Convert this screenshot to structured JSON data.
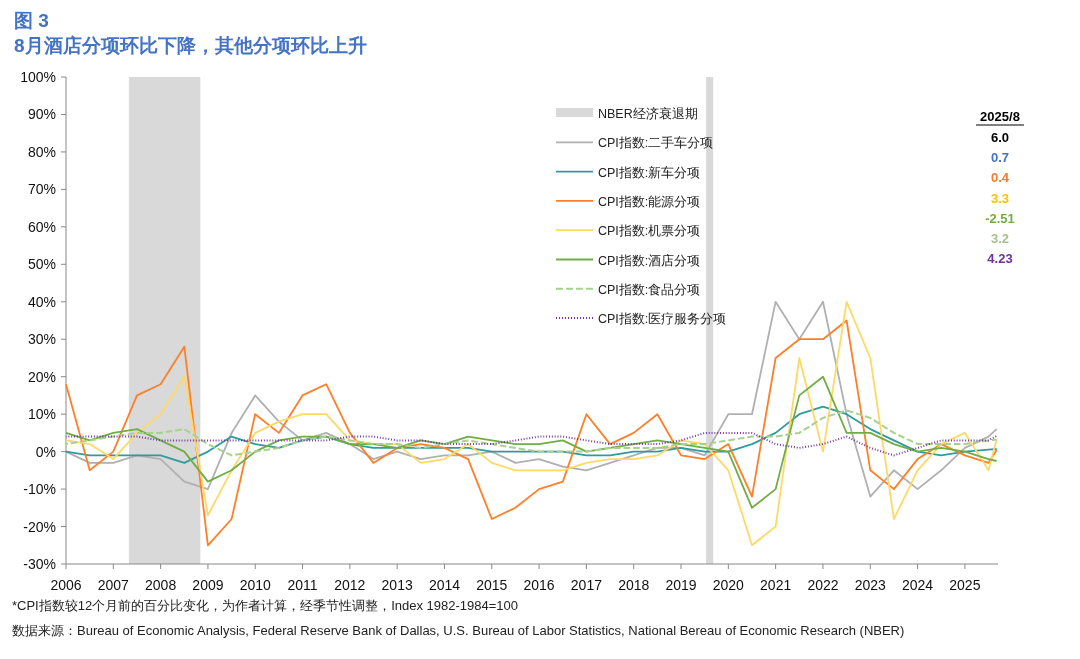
{
  "figure": {
    "label": "图 3",
    "title": "8月酒店分项环比下降，其他分项环比上升"
  },
  "chart": {
    "chart_data": {
      "type": "line",
      "x": [
        2006,
        2006.5,
        2007,
        2007.5,
        2008,
        2008.5,
        2009,
        2009.5,
        2010,
        2010.5,
        2011,
        2011.5,
        2012,
        2012.5,
        2013,
        2013.5,
        2014,
        2014.5,
        2015,
        2015.5,
        2016,
        2016.5,
        2017,
        2017.5,
        2018,
        2018.5,
        2019,
        2019.5,
        2020,
        2020.5,
        2021,
        2021.5,
        2022,
        2022.5,
        2023,
        2023.5,
        2024,
        2024.5,
        2025,
        2025.5,
        2025.67
      ],
      "series": [
        {
          "name": "CPI指数:二手车分项",
          "color": "#b0b0b0",
          "line_style": "solid",
          "values": [
            0,
            -3,
            -3,
            -1,
            -2,
            -8,
            -10,
            5,
            15,
            8,
            3,
            5,
            2,
            -2,
            0,
            -2,
            -1,
            -1,
            0,
            -3,
            -2,
            -4,
            -5,
            -3,
            -1,
            1,
            1,
            -1,
            10,
            10,
            40,
            30,
            40,
            10,
            -12,
            -5,
            -10,
            -5,
            1,
            4,
            6
          ]
        },
        {
          "name": "CPI指数:新车分项",
          "color": "#2e9c9c",
          "line_style": "solid",
          "values": [
            0,
            -1,
            -1,
            -1,
            -1,
            -3,
            0,
            4,
            2,
            1,
            3,
            4,
            2,
            1,
            1,
            1,
            1,
            1,
            0,
            0,
            0,
            0,
            -1,
            -1,
            0,
            0,
            1,
            0,
            0,
            2,
            5,
            10,
            12,
            10,
            6,
            3,
            0,
            -1,
            0,
            0.5,
            0.7
          ]
        },
        {
          "name": "CPI指数:能源分项",
          "color": "#ff7f27",
          "line_style": "solid",
          "values": [
            18,
            -5,
            0,
            15,
            18,
            28,
            -25,
            -18,
            10,
            5,
            15,
            18,
            5,
            -3,
            1,
            2,
            1,
            -2,
            -18,
            -15,
            -10,
            -8,
            10,
            2,
            5,
            10,
            -1,
            -2,
            2,
            -12,
            25,
            30,
            30,
            35,
            -5,
            -10,
            -2,
            2,
            -1,
            -3,
            0.4
          ]
        },
        {
          "name": "CPI指数:机票分项",
          "color": "#ffd966",
          "line_style": "solid",
          "values": [
            3,
            2,
            -2,
            5,
            10,
            20,
            -17,
            -5,
            5,
            8,
            10,
            10,
            3,
            2,
            2,
            -3,
            -2,
            2,
            -3,
            -5,
            -5,
            -5,
            -3,
            -2,
            -2,
            -1,
            3,
            2,
            -5,
            -25,
            -20,
            25,
            0,
            40,
            25,
            -18,
            -5,
            2,
            5,
            -5,
            3.3
          ]
        },
        {
          "name": "CPI指数:酒店分项",
          "color": "#70ad47",
          "line_style": "solid",
          "values": [
            5,
            3,
            5,
            6,
            3,
            0,
            -8,
            -5,
            0,
            3,
            4,
            4,
            2,
            2,
            1,
            3,
            2,
            4,
            3,
            2,
            2,
            3,
            0,
            1,
            2,
            3,
            2,
            1,
            0,
            -15,
            -10,
            15,
            20,
            5,
            5,
            2,
            0,
            1,
            0,
            -2,
            -2.5
          ]
        },
        {
          "name": "CPI指数:食品分项",
          "color": "#a9d18e",
          "line_style": "dashed",
          "values": [
            2,
            3,
            4,
            5,
            5,
            6,
            2,
            -1,
            0,
            1,
            3,
            4,
            3,
            2,
            2,
            1,
            2,
            3,
            2,
            1,
            0,
            0,
            0,
            1,
            1,
            1,
            2,
            2,
            3,
            4,
            4,
            5,
            9,
            11,
            9,
            5,
            2,
            2,
            2,
            3,
            3.2
          ]
        },
        {
          "name": "CPI指数:医疗服务分项",
          "color": "#7030a0",
          "line_style": "dotted",
          "values": [
            4,
            4,
            4,
            4,
            3,
            3,
            3,
            3,
            3,
            3,
            3,
            3,
            4,
            4,
            3,
            3,
            2,
            2,
            2,
            3,
            4,
            4,
            3,
            2,
            2,
            2,
            3,
            5,
            5,
            5,
            2,
            1,
            2,
            4,
            1,
            -1,
            1,
            3,
            3,
            3,
            4.2
          ]
        }
      ],
      "xlim": [
        2006,
        2025.7
      ],
      "ylim": [
        -30,
        100
      ],
      "xticks": [
        2006,
        2007,
        2008,
        2009,
        2010,
        2011,
        2012,
        2013,
        2014,
        2015,
        2016,
        2017,
        2018,
        2019,
        2020,
        2021,
        2022,
        2023,
        2024,
        2025
      ],
      "yticks": [
        {
          "value": -30,
          "label": "-30%"
        },
        {
          "value": -20,
          "label": "-20%"
        },
        {
          "value": -10,
          "label": "-10%"
        },
        {
          "value": 0,
          "label": "0%"
        },
        {
          "value": 10,
          "label": "10%"
        },
        {
          "value": 20,
          "label": "20%"
        },
        {
          "value": 30,
          "label": "30%"
        },
        {
          "value": 40,
          "label": "40%"
        },
        {
          "value": 50,
          "label": "50%"
        },
        {
          "value": 60,
          "label": "60%"
        },
        {
          "value": 70,
          "label": "70%"
        },
        {
          "value": 80,
          "label": "80%"
        },
        {
          "value": 90,
          "label": "90%"
        },
        {
          "value": 100,
          "label": "100%"
        }
      ],
      "bands": [
        {
          "axis": "x",
          "color": "#d9d9d9",
          "from": 2007.33,
          "to": 2008.84
        },
        {
          "axis": "x",
          "color": "#d9d9d9",
          "from": 2019.53,
          "to": 2019.68
        }
      ],
      "legend": true
    },
    "band_legend": {
      "label": "NBER经济衰退期"
    },
    "value_panel": {
      "heading": "2025/8",
      "values": [
        {
          "text": "6.0",
          "color": "#000000"
        },
        {
          "text": "0.7",
          "color": "#4472c4"
        },
        {
          "text": "0.4",
          "color": "#ed7d31"
        },
        {
          "text": "3.3",
          "color": "#ffc000"
        },
        {
          "text": "-2.51",
          "color": "#70ad47"
        },
        {
          "text": "3.2",
          "color": "#a9c08e"
        },
        {
          "text": "4.23",
          "color": "#7030a0"
        }
      ]
    }
  },
  "footnote": "*CPI指数较12个月前的百分比变化，为作者计算，经季节性调整，Index 1982-1984=100",
  "source": "数据来源：Bureau of Economic Analysis, Federal Reserve Bank of Dallas, U.S. Bureau of Labor Statistics, National Bereau of Economic Research (NBER)"
}
